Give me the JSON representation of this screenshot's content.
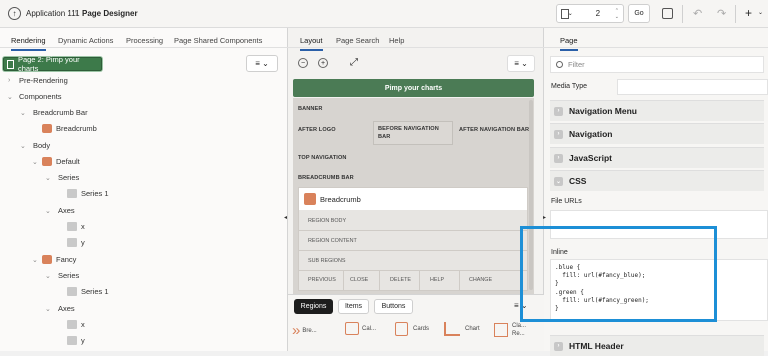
{
  "header": {
    "app_label": "Application 111",
    "separator": "\\",
    "title": "Page Designer",
    "page_number": "2",
    "go_label": "Go"
  },
  "left_tabs": [
    "Rendering",
    "Dynamic Actions",
    "Processing",
    "Page Shared Components"
  ],
  "tree": {
    "page_node": "Page 2: Pimp your charts",
    "pre_rendering": "Pre-Rendering",
    "components": "Components",
    "breadcrumb_bar": "Breadcrumb Bar",
    "breadcrumb": "Breadcrumb",
    "body": "Body",
    "default": "Default",
    "series": "Series",
    "series1": "Series 1",
    "axes": "Axes",
    "x": "x",
    "y": "y",
    "fancy": "Fancy",
    "series_b": "Series",
    "series1_b": "Series 1",
    "axes_b": "Axes",
    "x_b": "x",
    "y_b": "y"
  },
  "mid_tabs": [
    "Layout",
    "Page Search",
    "Help"
  ],
  "canvas": {
    "page_title_bar": "Pimp your charts",
    "banner": "BANNER",
    "after_logo": "AFTER LOGO",
    "before_nav": "BEFORE NAVIGATION BAR",
    "after_nav": "AFTER NAVIGATION BAR",
    "top_nav": "TOP NAVIGATION",
    "breadcrumb_bar": "BREADCRUMB BAR",
    "breadcrumb_region": "Breadcrumb",
    "region_body": "REGION BODY",
    "region_content": "REGION CONTENT",
    "sub_regions": "SUB REGIONS",
    "buttons_row": [
      "PREVIOUS",
      "CLOSE",
      "DELETE",
      "HELP",
      "CHANGE"
    ]
  },
  "gallery": {
    "tabs": [
      "Regions",
      "Items",
      "Buttons"
    ],
    "items": [
      "Bre...",
      "Cal...",
      "Cards",
      "Chart",
      "Cla... Re..."
    ]
  },
  "right": {
    "tab": "Page",
    "filter_placeholder": "Filter",
    "media_type_label": "Media Type",
    "sections": [
      "Navigation Menu",
      "Navigation",
      "JavaScript",
      "CSS",
      "HTML Header"
    ],
    "file_urls_label": "File URLs",
    "inline_label": "Inline",
    "inline_code": ".blue {\n  fill: url(#fancy_blue);\n}\n.green {\n  fill: url(#fancy_green);\n}"
  },
  "colors": {
    "highlight_box": "#1d8fd6",
    "page_node_bg": "#3d7a4a",
    "title_bar_bg": "#4b7b55",
    "tab_underline": "#2a5fa8"
  }
}
